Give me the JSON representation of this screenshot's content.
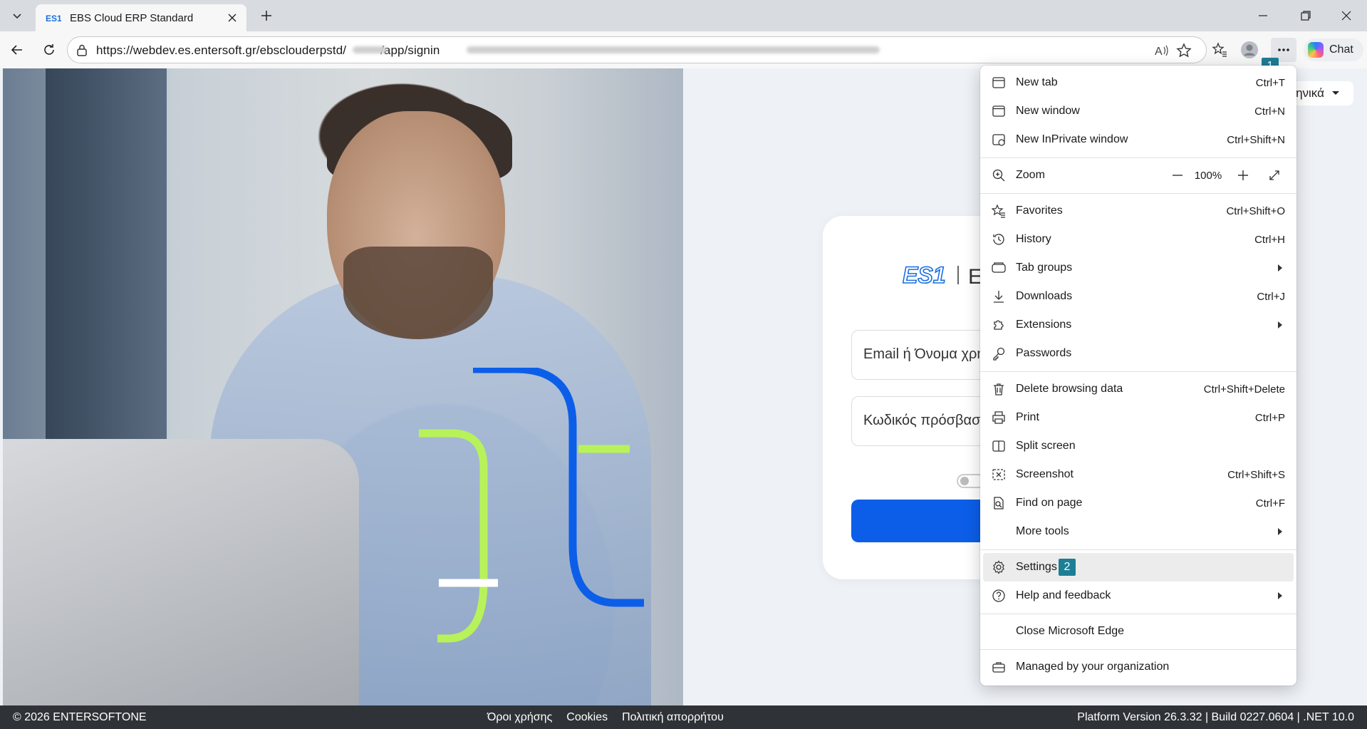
{
  "browser": {
    "tab_title": "EBS Cloud ERP Standard",
    "url": "https://webdev.es.entersoft.gr/ebsclouderpstd/",
    "url_tail": "/app/signin",
    "chat_label": "Chat",
    "step_badge_1": "1",
    "step_badge_2": "2"
  },
  "page": {
    "language": "ηνικά",
    "email_placeholder": "Email ή Όνομα χρή",
    "password_placeholder": "Κωδικός πρόσβασ",
    "footer": {
      "copyright": "© 2026 ENTERSOFTONE",
      "links": [
        "Όροι χρήσης",
        "Cookies",
        "Πολιτική απορρήτου"
      ],
      "version": "Platform Version 26.3.32 | Build 0227.0604 | .NET 10.0"
    }
  },
  "menu": {
    "items": [
      {
        "label": "New tab",
        "shortcut": "Ctrl+T",
        "icon": "new-tab-icon"
      },
      {
        "label": "New window",
        "shortcut": "Ctrl+N",
        "icon": "new-window-icon"
      },
      {
        "label": "New InPrivate window",
        "shortcut": "Ctrl+Shift+N",
        "icon": "inprivate-icon"
      },
      {
        "label": "Zoom",
        "zoom_value": "100%",
        "icon": "zoom-icon"
      },
      {
        "label": "Favorites",
        "shortcut": "Ctrl+Shift+O",
        "icon": "favorites-icon"
      },
      {
        "label": "History",
        "shortcut": "Ctrl+H",
        "icon": "history-icon"
      },
      {
        "label": "Tab groups",
        "icon": "tab-groups-icon"
      },
      {
        "label": "Downloads",
        "shortcut": "Ctrl+J",
        "icon": "downloads-icon"
      },
      {
        "label": "Extensions",
        "icon": "extensions-icon"
      },
      {
        "label": "Passwords",
        "icon": "passwords-icon"
      },
      {
        "label": "Delete browsing data",
        "shortcut": "Ctrl+Shift+Delete",
        "icon": "trash-icon"
      },
      {
        "label": "Print",
        "shortcut": "Ctrl+P",
        "icon": "print-icon"
      },
      {
        "label": "Split screen",
        "icon": "split-screen-icon"
      },
      {
        "label": "Screenshot",
        "shortcut": "Ctrl+Shift+S",
        "icon": "screenshot-icon"
      },
      {
        "label": "Find on page",
        "shortcut": "Ctrl+F",
        "icon": "find-icon"
      },
      {
        "label": "More tools",
        "icon": ""
      },
      {
        "label": "Settings",
        "icon": "gear-icon"
      },
      {
        "label": "Help and feedback",
        "icon": "help-icon"
      },
      {
        "label": "Close Microsoft Edge",
        "icon": ""
      },
      {
        "label": "Managed by your organization",
        "icon": "briefcase-icon"
      }
    ]
  },
  "colors": {
    "accent": "#0c5ee8",
    "badge": "#1d7e95",
    "footer_bg": "#2f3338",
    "lime": "#b8f25a"
  }
}
